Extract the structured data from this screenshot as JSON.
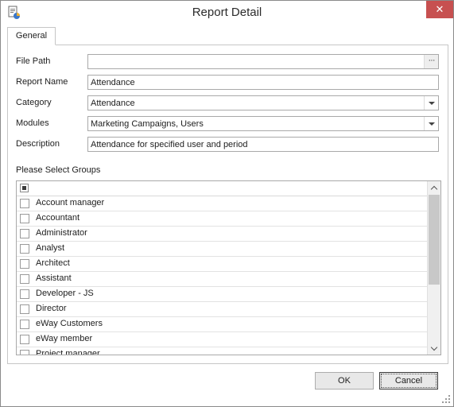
{
  "window": {
    "title": "Report Detail",
    "close_glyph": "✕"
  },
  "tabs": [
    {
      "label": "General"
    }
  ],
  "form": {
    "file_path": {
      "label": "File Path",
      "value": ""
    },
    "report_name": {
      "label": "Report Name",
      "value": "Attendance"
    },
    "category": {
      "label": "Category",
      "value": "Attendance"
    },
    "modules": {
      "label": "Modules",
      "value": "Marketing Campaigns, Users"
    },
    "description": {
      "label": "Description",
      "value": "Attendance for specified user and period"
    }
  },
  "groups": {
    "label": "Please Select Groups",
    "items": [
      "Account manager",
      "Accountant",
      "Administrator",
      "Analyst",
      "Architect",
      "Assistant",
      "Developer - JS",
      "Director",
      "eWay Customers",
      "eWay member",
      "Project manager"
    ]
  },
  "buttons": {
    "ok": "OK",
    "cancel": "Cancel"
  },
  "colors": {
    "close_button": "#c75050",
    "scroll_thumb": "#c8c8c8"
  },
  "icons": {
    "app": "report-window-icon",
    "browse": "ellipsis-icon",
    "dropdown": "dropdown-arrow-icon",
    "close": "close-icon",
    "resize": "resize-grip-icon"
  }
}
